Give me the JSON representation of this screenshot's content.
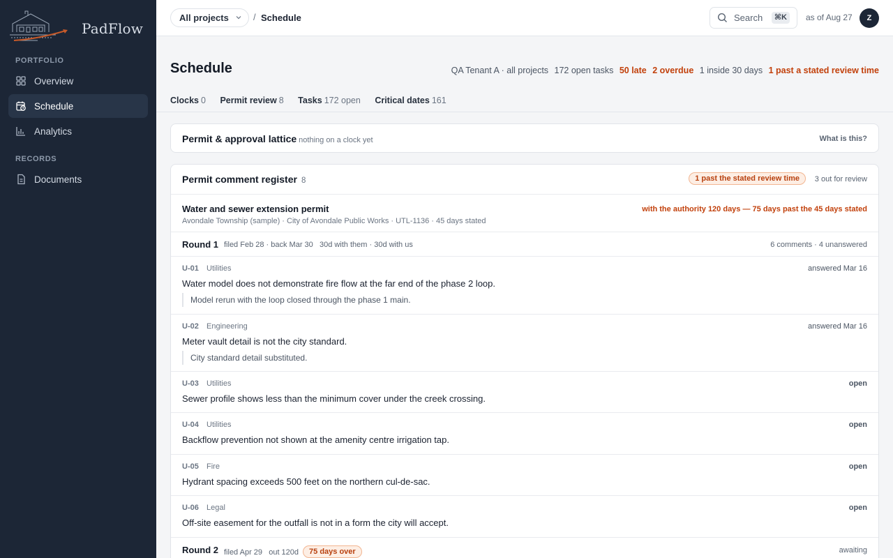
{
  "brand": {
    "name": "PadFlow"
  },
  "sidebar": {
    "sections": [
      {
        "label": "PORTFOLIO"
      },
      {
        "label": "RECORDS"
      }
    ],
    "items": [
      {
        "label": "Overview",
        "icon": "grid-icon"
      },
      {
        "label": "Schedule",
        "icon": "calendar-clock-icon",
        "active": true
      },
      {
        "label": "Analytics",
        "icon": "bar-chart-icon"
      },
      {
        "label": "Documents",
        "icon": "document-icon"
      }
    ]
  },
  "topbar": {
    "project_selector": "All projects",
    "separator": "/",
    "current": "Schedule",
    "search_label": "Search",
    "search_shortcut": "⌘K",
    "as_of": "as of Aug 27",
    "avatar_initial": "Z"
  },
  "header": {
    "title": "Schedule",
    "scope": "QA Tenant A · all projects",
    "open_tasks": "172 open tasks",
    "late": "50 late",
    "overdue": "2 overdue",
    "inside": "1 inside 30 days",
    "past_review": "1 past a stated review time",
    "tabs": [
      {
        "label": "Clocks",
        "count": "0"
      },
      {
        "label": "Permit review",
        "count": "8"
      },
      {
        "label": "Tasks",
        "count": "172 open"
      },
      {
        "label": "Critical dates",
        "count": "161"
      }
    ]
  },
  "lattice": {
    "title": "Permit & approval lattice",
    "subtitle": "nothing on a clock yet",
    "help": "What is this?"
  },
  "register": {
    "title": "Permit comment register",
    "count": "8",
    "badge": "1 past the stated review time",
    "out_for_review": "3 out for review",
    "permit": {
      "name": "Water and sewer extension permit",
      "meta": "Avondale Township (sample) · City of Avondale Public Works · UTL-1136 · 45 days stated",
      "status": "with the authority 120 days — 75 days past the 45 days stated"
    },
    "round1": {
      "label": "Round 1",
      "meta": "filed Feb 28 · back Mar 30   30d with them · 30d with us",
      "summary": "6 comments · 4 unanswered"
    },
    "comments": [
      {
        "id": "U-01",
        "category": "Utilities",
        "status": "answered Mar 16",
        "text": "Water model does not demonstrate fire flow at the far end of the phase 2 loop.",
        "reply": "Model rerun with the loop closed through the phase 1 main."
      },
      {
        "id": "U-02",
        "category": "Engineering",
        "status": "answered Mar 16",
        "text": "Meter vault detail is not the city standard.",
        "reply": "City standard detail substituted."
      },
      {
        "id": "U-03",
        "category": "Utilities",
        "status": "open",
        "text": "Sewer profile shows less than the minimum cover under the creek crossing."
      },
      {
        "id": "U-04",
        "category": "Utilities",
        "status": "open",
        "text": "Backflow prevention not shown at the amenity centre irrigation tap."
      },
      {
        "id": "U-05",
        "category": "Fire",
        "status": "open",
        "text": "Hydrant spacing exceeds 500 feet on the northern cul-de-sac."
      },
      {
        "id": "U-06",
        "category": "Legal",
        "status": "open",
        "text": "Off-site easement for the outfall is not in a form the city will accept."
      }
    ],
    "round2": {
      "label": "Round 2",
      "meta": "filed Apr 29   out 120d",
      "badge": "75 days over",
      "summary": "awaiting"
    }
  },
  "colors": {
    "sidebar_bg": "#1c2636",
    "warning": "#c2410c",
    "badge_bg": "#fdeee4"
  }
}
